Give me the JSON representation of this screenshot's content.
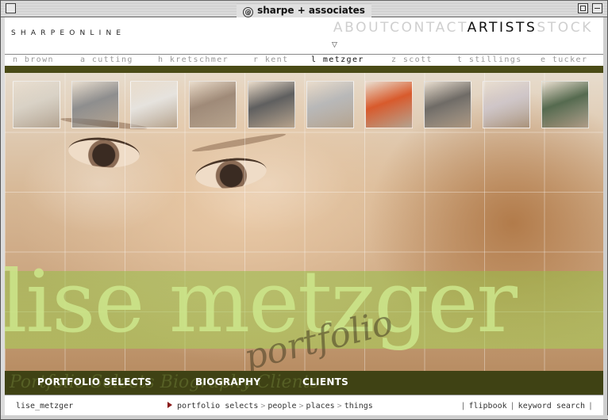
{
  "window": {
    "title": "sharpe + associates"
  },
  "header": {
    "logo": "SHARPEONLINE",
    "nav": [
      {
        "label": "ABOUT",
        "active": false
      },
      {
        "label": "CONTACT",
        "active": false
      },
      {
        "label": "ARTISTS",
        "active": true
      },
      {
        "label": "STOCK",
        "active": false
      }
    ]
  },
  "artists": [
    {
      "label": "n brown",
      "active": false
    },
    {
      "label": "a cutting",
      "active": false
    },
    {
      "label": "h kretschmer",
      "active": false
    },
    {
      "label": "r kent",
      "active": false
    },
    {
      "label": "l metzger",
      "active": true
    },
    {
      "label": "z scott",
      "active": false
    },
    {
      "label": "t stillings",
      "active": false
    },
    {
      "label": "e tucker",
      "active": false
    }
  ],
  "thumbnails": [
    {
      "name": "thumb-interior-chair",
      "color": "#d9d2c6"
    },
    {
      "name": "thumb-man-hat-back",
      "color": "#8e8e8e"
    },
    {
      "name": "thumb-woman-lying",
      "color": "#e6e3de"
    },
    {
      "name": "thumb-doorway-room",
      "color": "#9f8a78"
    },
    {
      "name": "thumb-man-reading",
      "color": "#5f5f5f"
    },
    {
      "name": "thumb-bride-street",
      "color": "#b8b8b8"
    },
    {
      "name": "thumb-yellow-socks",
      "color": "#d85a2c"
    },
    {
      "name": "thumb-dark-fabric",
      "color": "#6f6b66"
    },
    {
      "name": "thumb-girl-window",
      "color": "#cfc6c8"
    },
    {
      "name": "thumb-couple-garden",
      "color": "#556a4f"
    }
  ],
  "hero": {
    "name": "lise metzger",
    "subtitle": "portfolio"
  },
  "bottom_nav": {
    "ghost_text": "Portfolio Selects   Biography   Clients",
    "items": [
      "PORTFOLIO SELECTS",
      "BIOGRAPHY",
      "CLIENTS"
    ]
  },
  "footer": {
    "left": "lise_metzger",
    "crumbs": [
      "portfolio selects",
      "people",
      "places",
      "things"
    ],
    "links": [
      "flipbook",
      "keyword search"
    ]
  }
}
